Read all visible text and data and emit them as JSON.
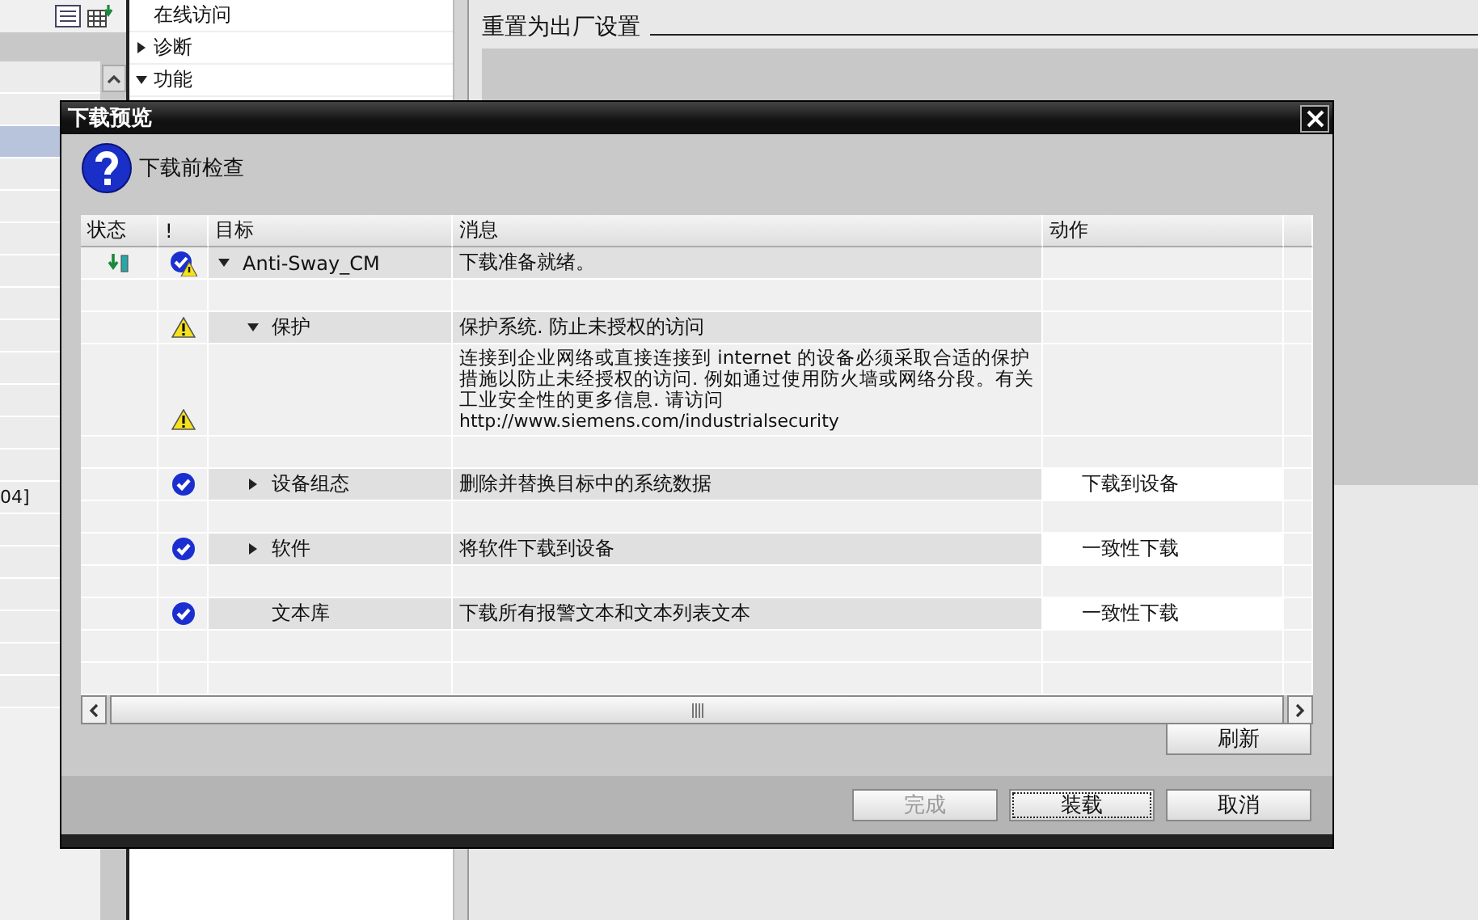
{
  "background": {
    "left_fragment": "04]",
    "tree": [
      {
        "label": "在线访问"
      },
      {
        "label": "诊断",
        "expanded": false
      },
      {
        "label": "功能",
        "expanded": true
      }
    ],
    "section_title": "重置为出厂设置"
  },
  "dialog": {
    "title": "下载预览",
    "heading": "下载前检查",
    "columns": [
      "状态",
      "!",
      "目标",
      "消息",
      "动作"
    ],
    "rows": [
      {
        "download_pending": true,
        "ready": true,
        "warning": true,
        "target": "Anti-Sway_CM",
        "expanded": true,
        "message": "下载准备就绪。",
        "children": [
          {
            "download_pending": false,
            "ready": false,
            "warning": true,
            "target": "保护",
            "expanded": true,
            "message": "保护系统. 防止未授权的访问",
            "children": [
              {
                "download_pending": false,
                "ready": false,
                "warning": true,
                "message": "连接到企业网络或直接连接到 internet 的设备必须采取合适的保护措施以防止未经授权的访问. 例如通过使用防火墙或网络分段。有关工业安全性的更多信息. 请访问",
                "link": "http://www.siemens.com/industrialsecurity"
              }
            ]
          },
          {
            "download_pending": false,
            "ready": true,
            "warning": false,
            "target": "设备组态",
            "expanded": false,
            "message": "删除并替换目标中的系统数据",
            "action": "下载到设备"
          },
          {
            "download_pending": false,
            "ready": true,
            "warning": false,
            "target": "软件",
            "expanded": false,
            "message": "将软件下载到设备",
            "action": "一致性下载"
          },
          {
            "download_pending": false,
            "ready": true,
            "warning": false,
            "target": "文本库",
            "message": "下载所有报警文本和文本列表文本",
            "action": "一致性下载"
          }
        ]
      }
    ],
    "refresh_button": "刷新",
    "buttons": [
      {
        "label": "完成",
        "disabled": true,
        "focused": false
      },
      {
        "label": "装载",
        "disabled": false,
        "focused": true
      },
      {
        "label": "取消",
        "disabled": false,
        "focused": false
      }
    ]
  }
}
